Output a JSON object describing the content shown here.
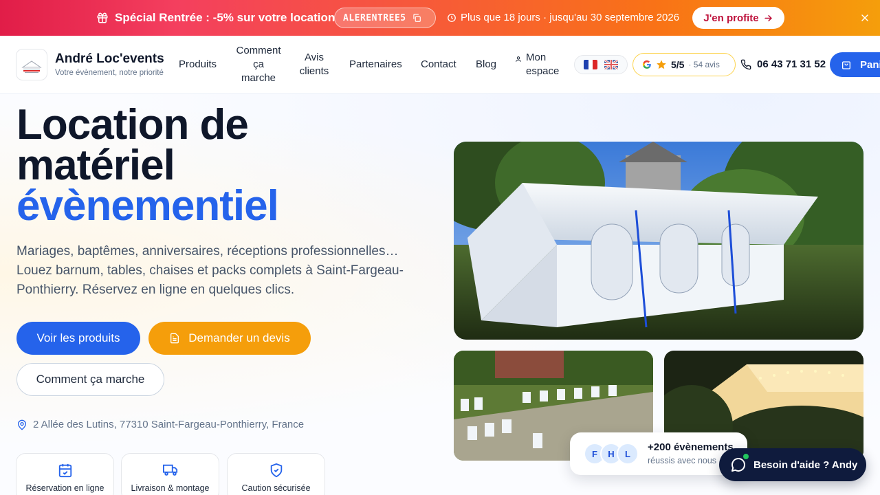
{
  "promo": {
    "title": "Spécial Rentrée : -5% sur votre location",
    "code": "ALERENTREE5",
    "deadline": "Plus que 18 jours · jusqu'au 30 septembre 2026",
    "cta": "J'en profite"
  },
  "header": {
    "brand_name": "André Loc'events",
    "tagline": "Votre évènement, notre priorité",
    "nav": {
      "produits": "Produits",
      "comment_l1": "Comment",
      "comment_l2": "ça",
      "comment_l3": "marche",
      "avis_l1": "Avis",
      "avis_l2": "clients",
      "partenaires": "Partenaires",
      "contact": "Contact",
      "blog": "Blog",
      "espace_l1": "Mon",
      "espace_l2": "espace"
    },
    "rating_score": "5/5",
    "rating_count": "· 54 avis",
    "phone": "06 43 71 31 52",
    "cart": "Panier"
  },
  "hero": {
    "title_line1": "Location de",
    "title_line2": "matériel",
    "title_accent": "évènementiel",
    "lead": "Mariages, baptêmes, anniversaires, réceptions professionnelles… Louez barnum, tables, chaises et packs complets à Saint-Fargeau-Ponthierry. Réservez en ligne en quelques clics.",
    "btn_products": "Voir les produits",
    "btn_quote": "Demander un devis",
    "btn_how": "Comment ça marche",
    "address": "2 Allée des Lutins, 77310 Saint-Fargeau-Ponthierry, France",
    "features": [
      "Réservation en ligne",
      "Livraison & montage",
      "Caution sécurisée"
    ]
  },
  "social_proof": {
    "avatars": [
      "F",
      "H",
      "L"
    ],
    "title": "+200 évènements",
    "subtitle": "réussis avec nous"
  },
  "help": {
    "label": "Besoin d'aide ? Andy"
  },
  "colors": {
    "primary": "#2563eb",
    "accent_orange": "#f59e0b",
    "promo_start": "#e11d48",
    "promo_end": "#f59e0b",
    "dark": "#0f172a"
  }
}
